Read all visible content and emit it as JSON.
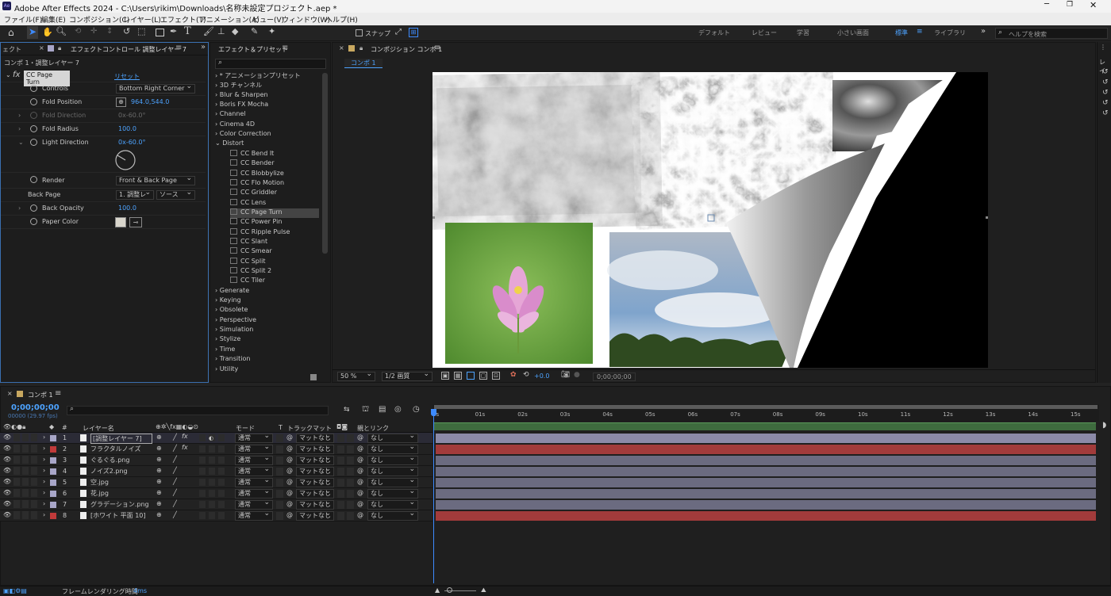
{
  "window": {
    "title": "Adobe After Effects 2024 - C:\\Users\\rikim\\Downloads\\名称未設定プロジェクト.aep *",
    "app_icon": "Ae"
  },
  "menu": [
    "ファイル(F)",
    "編集(E)",
    "コンポジション(C)",
    "レイヤー(L)",
    "エフェクト(T)",
    "アニメーション(A)",
    "ビュー(V)",
    "ウィンドウ(W)",
    "ヘルプ(H)"
  ],
  "toolbar": {
    "snap_label": "スナップ",
    "workspaces": [
      "デフォルト",
      "レビュー",
      "学習",
      "小さい画面",
      "標準",
      "ライブラリ"
    ],
    "active_workspace": "標準",
    "search_placeholder": "ヘルプを検索"
  },
  "effect_controls": {
    "tab_left": "ェクト",
    "tab_title": "エフェクトコントロール 調整レイヤー 7",
    "breadcrumb": "コンポ 1・調整レイヤー 7",
    "effect_name": "CC Page Turn",
    "reset": "リセット",
    "rows": [
      {
        "label": "Controls",
        "value": "Bottom Right Corner",
        "type": "dropdown"
      },
      {
        "label": "Fold Position",
        "value": "964.0,544.0",
        "type": "point"
      },
      {
        "label": "Fold Direction",
        "value": "0x-60.0°",
        "type": "dim"
      },
      {
        "label": "Fold Radius",
        "value": "100.0",
        "type": "number"
      },
      {
        "label": "Light Direction",
        "value": "0x-60.0°",
        "type": "angle"
      },
      {
        "label": "Render",
        "value": "Front & Back Page",
        "type": "dropdown"
      },
      {
        "label": "Back Page",
        "value": "1. 調整レ",
        "value2": "ソース",
        "type": "double"
      },
      {
        "label": "Back Opacity",
        "value": "100.0",
        "type": "number"
      },
      {
        "label": "Paper Color",
        "value": "",
        "type": "color"
      }
    ],
    "paper_color": "#d9d6cc"
  },
  "effects_presets": {
    "title": "エフェクト＆プリセット",
    "search_placeholder": "",
    "items": [
      {
        "label": "* アニメーションプリセット",
        "level": 0
      },
      {
        "label": "3D チャンネル",
        "level": 0
      },
      {
        "label": "Blur & Sharpen",
        "level": 0
      },
      {
        "label": "Boris FX Mocha",
        "level": 0
      },
      {
        "label": "Channel",
        "level": 0
      },
      {
        "label": "Cinema 4D",
        "level": 0
      },
      {
        "label": "Color Correction",
        "level": 0
      },
      {
        "label": "Distort",
        "level": 0,
        "open": true
      },
      {
        "label": "CC Bend It",
        "level": 1
      },
      {
        "label": "CC Bender",
        "level": 1
      },
      {
        "label": "CC Blobbylize",
        "level": 1
      },
      {
        "label": "CC Flo Motion",
        "level": 1
      },
      {
        "label": "CC Griddler",
        "level": 1
      },
      {
        "label": "CC Lens",
        "level": 1
      },
      {
        "label": "CC Page Turn",
        "level": 1,
        "selected": true
      },
      {
        "label": "CC Power Pin",
        "level": 1
      },
      {
        "label": "CC Ripple Pulse",
        "level": 1
      },
      {
        "label": "CC Slant",
        "level": 1
      },
      {
        "label": "CC Smear",
        "level": 1
      },
      {
        "label": "CC Split",
        "level": 1
      },
      {
        "label": "CC Split 2",
        "level": 1
      },
      {
        "label": "CC Tiler",
        "level": 1
      },
      {
        "label": "Generate",
        "level": 0
      },
      {
        "label": "Keying",
        "level": 0
      },
      {
        "label": "Obsolete",
        "level": 0
      },
      {
        "label": "Perspective",
        "level": 0
      },
      {
        "label": "Simulation",
        "level": 0
      },
      {
        "label": "Stylize",
        "level": 0
      },
      {
        "label": "Time",
        "level": 0
      },
      {
        "label": "Transition",
        "level": 0
      },
      {
        "label": "Utility",
        "level": 0
      }
    ]
  },
  "composition": {
    "tab_title": "コンポジション コンポ 1",
    "sub_tab": "コンポ 1",
    "zoom": "50 %",
    "resolution": "1/2 画質",
    "exposure": "+0.0",
    "timecode": "0;00;00;00"
  },
  "timeline": {
    "tab": "コンポ 1",
    "timecode": "0;00;00;00",
    "fps": "00000 (29.97 fps)",
    "headers": {
      "num": "#",
      "layer_name": "レイヤー名",
      "mode": "モード",
      "t": "T",
      "trackmatte": "トラックマット",
      "parent": "親とリンク"
    },
    "ruler": [
      "0s",
      "01s",
      "02s",
      "03s",
      "04s",
      "05s",
      "06s",
      "07s",
      "08s",
      "09s",
      "10s",
      "11s",
      "12s",
      "13s",
      "14s",
      "15s"
    ],
    "layers": [
      {
        "num": "1",
        "name": "[調整レイヤー 7]",
        "label_color": "#a8a6c8",
        "mode": "通常",
        "matte": "マットなし",
        "parent": "なし",
        "fx": true,
        "bar": "#8b8aa8"
      },
      {
        "num": "2",
        "name": "フラクタルノイズ",
        "label_color": "#c03a3a",
        "mode": "通常",
        "matte": "マットなし",
        "parent": "なし",
        "fx": true,
        "bar": "#a23b3b"
      },
      {
        "num": "3",
        "name": "ぐるぐる.png",
        "label_color": "#a8a6c8",
        "mode": "通常",
        "matte": "マットなし",
        "parent": "なし",
        "fx": false,
        "bar": "#6b6b80"
      },
      {
        "num": "4",
        "name": "ノイズ2.png",
        "label_color": "#a8a6c8",
        "mode": "通常",
        "matte": "マットなし",
        "parent": "なし",
        "fx": false,
        "bar": "#6b6b80"
      },
      {
        "num": "5",
        "name": "空.jpg",
        "label_color": "#a8a6c8",
        "mode": "通常",
        "matte": "マットなし",
        "parent": "なし",
        "fx": false,
        "bar": "#6b6b80"
      },
      {
        "num": "6",
        "name": "花.jpg",
        "label_color": "#a8a6c8",
        "mode": "通常",
        "matte": "マットなし",
        "parent": "なし",
        "fx": false,
        "bar": "#6b6b80"
      },
      {
        "num": "7",
        "name": "グラデーション.png",
        "label_color": "#a8a6c8",
        "mode": "通常",
        "matte": "マットなし",
        "parent": "なし",
        "fx": false,
        "bar": "#6b6b80"
      },
      {
        "num": "8",
        "name": "[ホワイト 平面 10]",
        "label_color": "#c03a3a",
        "mode": "通常",
        "matte": "マットなし",
        "parent": "なし",
        "fx": false,
        "bar": "#a23b3b"
      }
    ]
  },
  "status": {
    "render_label": "フレームレンダリング時間",
    "render_time": "4ms"
  }
}
